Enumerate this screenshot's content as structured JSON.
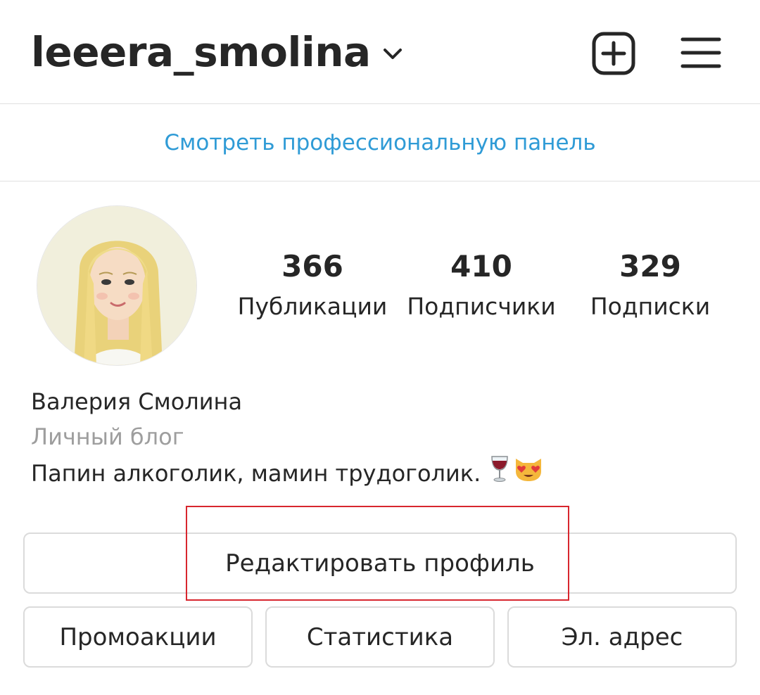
{
  "header": {
    "username": "leeera_smolina",
    "icons": [
      "chevron-down-icon",
      "plus-square-icon",
      "hamburger-menu-icon"
    ]
  },
  "professional_dashboard": {
    "link_label": "Смотреть профессиональную панель",
    "color": "#2f9bd6"
  },
  "stats": {
    "posts": {
      "count": "366",
      "label": "Публикации"
    },
    "followers": {
      "count": "410",
      "label": "Подписчики"
    },
    "following": {
      "count": "329",
      "label": "Подписки"
    }
  },
  "bio": {
    "name": "Валерия Смолина",
    "category": "Личный блог",
    "text": "Папин алкоголик, мамин трудоголик.",
    "emojis": [
      "wine-glass-icon",
      "heart-eyes-cat-icon"
    ]
  },
  "buttons": {
    "edit_profile": "Редактировать профиль",
    "promotions": "Промоакции",
    "insights": "Статистика",
    "email": "Эл. адрес"
  },
  "annotation": {
    "highlight_color": "#d8262e"
  }
}
